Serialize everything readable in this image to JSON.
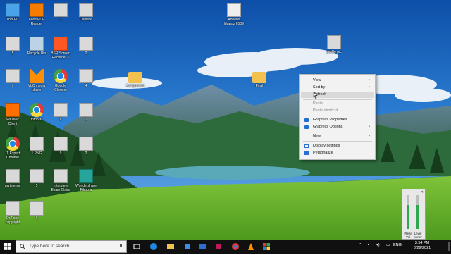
{
  "desktop": {
    "icons": [
      {
        "label": "This PC",
        "icon": "computer-icon"
      },
      {
        "label": "Foxit PDF\nReader",
        "icon": "pdf-icon"
      },
      {
        "label": "3",
        "icon": "image-file-icon"
      },
      {
        "label": "Capture",
        "icon": "image-file-icon"
      },
      {
        "label": "5",
        "icon": "image-file-icon"
      },
      {
        "label": "Recycle Bin",
        "icon": "recycle-bin-icon"
      },
      {
        "label": "BSR Screen\nRecorder 6",
        "icon": "recorder-icon"
      },
      {
        "label": "2",
        "icon": "image-file-icon"
      },
      {
        "label": "Adeeba\nNawaz 6509",
        "icon": "document-icon"
      },
      {
        "label": "profile pic",
        "icon": "image-file-icon"
      },
      {
        "label": "7",
        "icon": "image-file-icon"
      },
      {
        "label": "VLC media\nplayer",
        "icon": "vlc-icon"
      },
      {
        "label": "Google\nChrome",
        "icon": "chrome-icon"
      },
      {
        "label": "4",
        "icon": "image-file-icon"
      },
      {
        "label": "Assignment",
        "icon": "folder-icon"
      },
      {
        "label": "Final",
        "icon": "folder-icon"
      },
      {
        "label": "WO Mic\nClient",
        "icon": "mic-icon"
      },
      {
        "label": "foto300",
        "icon": "chrome-icon"
      },
      {
        "label": "8",
        "icon": "image-file-icon"
      },
      {
        "label": "1",
        "icon": "image-file-icon"
      },
      {
        "label": "IT Expert\nChrome",
        "icon": "chrome-icon"
      },
      {
        "label": "1.PNG",
        "icon": "image-file-icon"
      },
      {
        "label": "9",
        "icon": "image-file-icon"
      },
      {
        "label": "2",
        "icon": "image-file-icon"
      },
      {
        "label": "mytelenor",
        "icon": "image-file-icon"
      },
      {
        "label": "5",
        "icon": "image-file-icon"
      },
      {
        "label": "Interview\nExam Claim",
        "icon": "image-file-icon"
      },
      {
        "label": "Wondershare\nFilmora",
        "icon": "filmora-icon"
      },
      {
        "label": "Dr.Fone\ncopyright",
        "icon": "image-file-icon"
      },
      {
        "label": "6",
        "icon": "image-file-icon"
      }
    ]
  },
  "context_menu": {
    "items": [
      {
        "label": "View",
        "has_submenu": true
      },
      {
        "label": "Sort by",
        "has_submenu": true
      },
      {
        "label": "Refresh",
        "highlighted": true
      },
      {
        "label": "Paste",
        "disabled": true
      },
      {
        "label": "Paste shortcut",
        "disabled": true
      },
      {
        "label": "Graphics Properties...",
        "icon": "intel-graphics-icon"
      },
      {
        "label": "Graphics Options",
        "icon": "intel-graphics-icon",
        "has_submenu": true
      },
      {
        "label": "New",
        "has_submenu": true
      },
      {
        "label": "Display settings",
        "icon": "display-icon"
      },
      {
        "label": "Personalize",
        "icon": "personalize-icon"
      }
    ]
  },
  "taskbar": {
    "search_placeholder": "Type here to search",
    "language": "ENG",
    "time": "3:54 PM",
    "date": "8/29/2021"
  },
  "volume_mixer": {
    "left_label": "Real\nVol",
    "right_label": "Level\nMeter",
    "level": 0.7
  },
  "colors": {
    "taskbar_bg": "#101010",
    "menu_bg": "#f2f2f2",
    "menu_highlight": "#d9d9d9"
  }
}
